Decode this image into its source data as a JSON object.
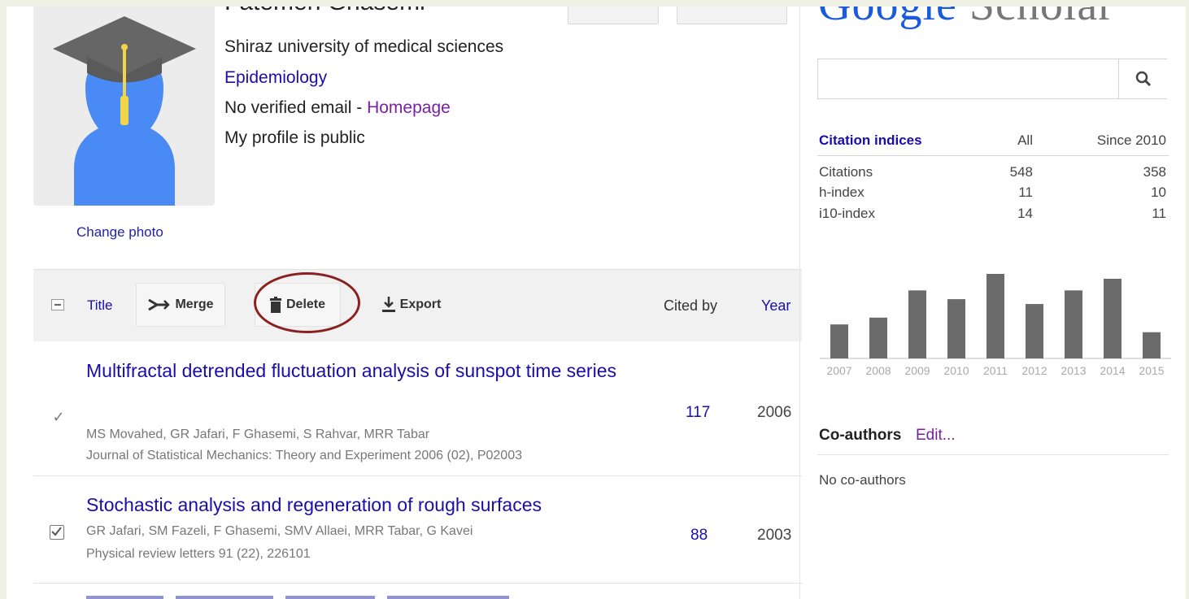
{
  "profile": {
    "name": "Fatemeh Ghasemi",
    "affiliation": "Shiraz university of medical sciences",
    "field": "Epidemiology",
    "email_text": "No verified email - ",
    "homepage_label": "Homepage",
    "visibility": "My profile is public",
    "change_photo": "Change photo"
  },
  "toolbar": {
    "title_col": "Title",
    "merge_label": "Merge",
    "delete_label": "Delete",
    "export_label": "Export",
    "cited_by_col": "Cited by",
    "year_col": "Year"
  },
  "articles": [
    {
      "title": "Multifractal detrended fluctuation analysis of sunspot time series",
      "authors": "MS Movahed, GR Jafari, F Ghasemi, S Rahvar, MRR Tabar",
      "venue": "Journal of Statistical Mechanics: Theory and Experiment 2006 (02), P02003",
      "cited_by": "117",
      "year": "2006"
    },
    {
      "title": "Stochastic analysis and regeneration of rough surfaces",
      "authors": "GR Jafari, SM Fazeli, F Ghasemi, SMV Allaei, MRR Tabar, G Kavei",
      "venue": "Physical review letters 91 (22), 226101",
      "cited_by": "88",
      "year": "2003"
    }
  ],
  "scholar": {
    "logo_word1": "Google",
    "logo_word2": "Scholar",
    "search_placeholder": ""
  },
  "citation_indices": {
    "header": "Citation indices",
    "col_all": "All",
    "col_since": "Since 2010",
    "rows": [
      {
        "label": "Citations",
        "all": "548",
        "since": "358"
      },
      {
        "label": "h-index",
        "all": "11",
        "since": "10"
      },
      {
        "label": "i10-index",
        "all": "14",
        "since": "11"
      }
    ]
  },
  "chart_data": {
    "type": "bar",
    "categories": [
      "2007",
      "2008",
      "2009",
      "2010",
      "2011",
      "2012",
      "2013",
      "2014",
      "2015"
    ],
    "values": [
      35,
      42,
      70,
      61,
      87,
      56,
      70,
      82,
      27
    ],
    "bar_color": "#6b6b6b",
    "title": "",
    "xlabel": "",
    "ylabel": ""
  },
  "coauthors": {
    "title": "Co-authors",
    "edit_label": "Edit...",
    "empty_text": "No co-authors"
  },
  "colors": {
    "link": "#1a0dab",
    "visited": "#7b1fa2",
    "annotation_circle": "#8a2020"
  }
}
